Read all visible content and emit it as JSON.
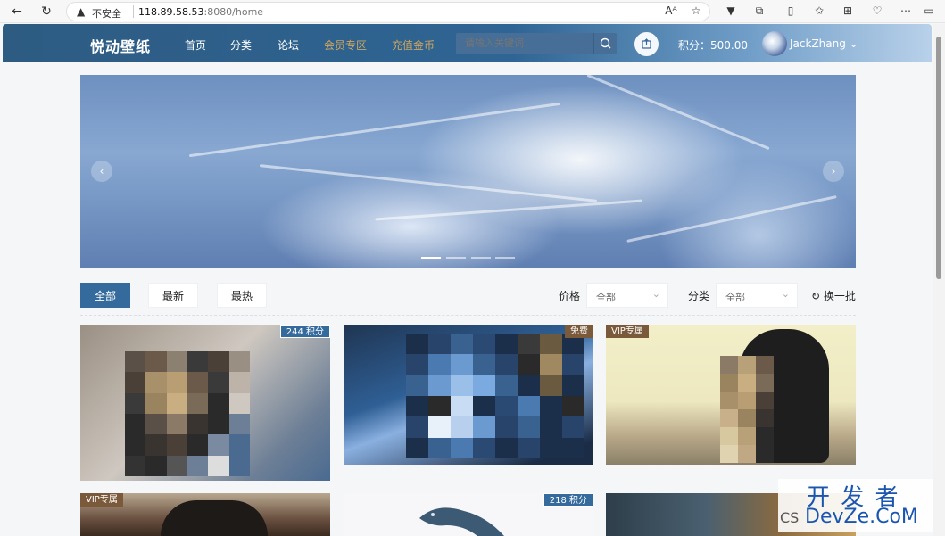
{
  "browser": {
    "insecure_label": "不安全",
    "url_host": "118.89.58.53",
    "url_rest": ":8080/home"
  },
  "header": {
    "logo": "悦动壁纸",
    "nav": [
      "首页",
      "分类",
      "论坛",
      "会员专区",
      "充值金币"
    ],
    "search_placeholder": "请输入关键词",
    "points_label": "积分：500.00",
    "username": "JackZhang"
  },
  "filters": {
    "tabs": [
      "全部",
      "最新",
      "最热"
    ],
    "price_label": "价格",
    "price_value": "全部",
    "category_label": "分类",
    "category_value": "全部",
    "refresh_label": "换一批"
  },
  "cards": [
    {
      "badge": "244 积分",
      "badge_type": "points"
    },
    {
      "badge": "免费",
      "badge_type": "free"
    },
    {
      "badge": "VIP专属",
      "badge_type": "vip"
    },
    {
      "badge": "VIP专属",
      "badge_type": "vip"
    },
    {
      "badge": "218 积分",
      "badge_type": "points"
    },
    {
      "badge": "",
      "badge_type": "none"
    }
  ],
  "watermark": {
    "line1": "开 发 者",
    "line2": "DevZe.CoM",
    "prefix": "CS"
  },
  "colors": {
    "primary": "#346a9c",
    "gold": "#d0a65f",
    "header_start": "#2d5b82",
    "header_end": "#b9d1ea",
    "watermark": "#1a56b0"
  }
}
